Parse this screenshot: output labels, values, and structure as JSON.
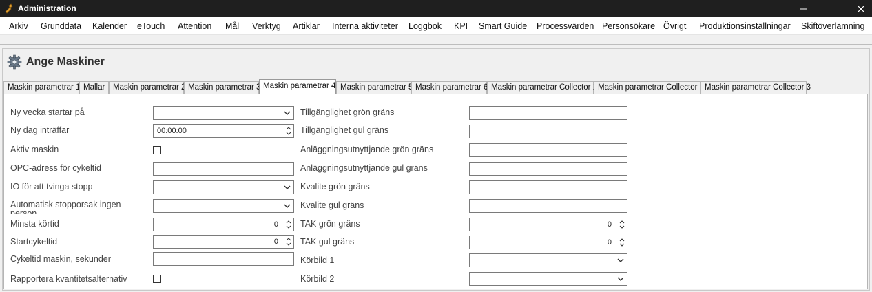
{
  "window": {
    "title": "Administration"
  },
  "menu": [
    "Arkiv",
    "Grunddata",
    "Kalender",
    "eTouch",
    "Attention",
    "Mål",
    "Verktyg",
    "Artiklar",
    "Interna aktiviteter",
    "Loggbok",
    "KPI",
    "Smart Guide",
    "Processvärden",
    "Personsökare",
    "Övrigt",
    "Produktionsinställningar",
    "Skiftöverlämning"
  ],
  "page": {
    "title": "Ange Maskiner"
  },
  "tabs": [
    "Maskin parametrar 1",
    "Mallar",
    "Maskin parametrar 2",
    "Maskin parametrar 3",
    "Maskin parametrar 4",
    "Maskin parametrar 5",
    "Maskin parametrar 6",
    "Maskin parametrar Collector 1",
    "Maskin parametrar Collector 2",
    "Maskin parametrar Collector 3"
  ],
  "active_tab": "Maskin parametrar 4",
  "left": {
    "ny_vecka": {
      "label": "Ny vecka startar på",
      "value": ""
    },
    "ny_dag": {
      "label": "Ny dag inträffar",
      "value": "00:00:00"
    },
    "aktiv": {
      "label": "Aktiv maskin",
      "checked": false
    },
    "opc": {
      "label": "OPC-adress för cykeltid",
      "value": ""
    },
    "io_stopp": {
      "label": "IO för att tvinga stopp",
      "value": ""
    },
    "auto_stopp": {
      "label": "Automatisk stopporsak ingen person",
      "value": ""
    },
    "minsta_kortid": {
      "label": "Minsta körtid",
      "value": "0"
    },
    "startcykeltid": {
      "label": "Startcykeltid",
      "value": "0"
    },
    "cykeltid": {
      "label": "Cykeltid maskin, sekunder",
      "value": ""
    },
    "rapportera": {
      "label": "Rapportera kvantitetsalternativ",
      "checked": false
    }
  },
  "right": {
    "tillg_gron": {
      "label": "Tillgänglighet grön gräns",
      "value": ""
    },
    "tillg_gul": {
      "label": "Tillgänglighet gul gräns",
      "value": ""
    },
    "anl_gron": {
      "label": "Anläggningsutnyttjande grön gräns",
      "value": ""
    },
    "anl_gul": {
      "label": "Anläggningsutnyttjande gul gräns",
      "value": ""
    },
    "kval_gron": {
      "label": "Kvalite grön gräns",
      "value": ""
    },
    "kval_gul": {
      "label": "Kvalite gul gräns",
      "value": ""
    },
    "tak_gron": {
      "label": "TAK grön gräns",
      "value": "0"
    },
    "tak_gul": {
      "label": "TAK gul gräns",
      "value": "0"
    },
    "korbild1": {
      "label": "Körbild 1",
      "value": ""
    },
    "korbild2": {
      "label": "Körbild 2",
      "value": ""
    }
  }
}
